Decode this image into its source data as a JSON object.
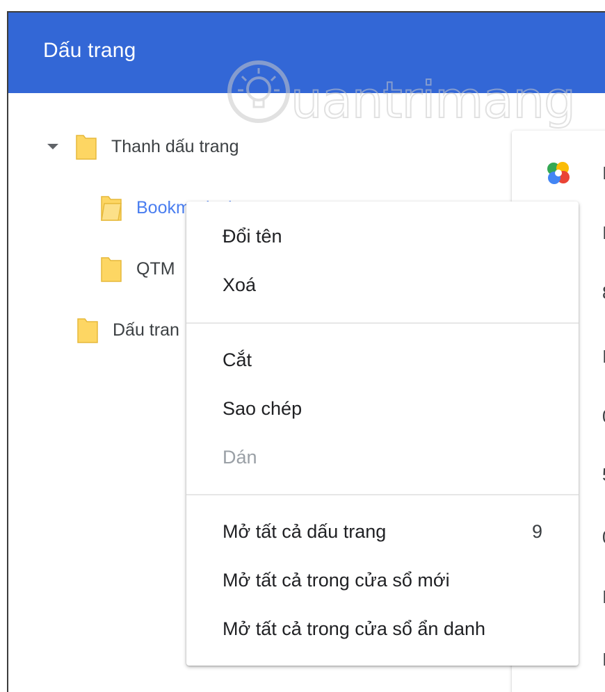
{
  "header": {
    "title": "Dấu trang"
  },
  "watermark": {
    "text": "uantrimang"
  },
  "tree": {
    "items": [
      {
        "label": "Thanh dấu trang",
        "expanded": true
      },
      {
        "label": "Bookmarks bar",
        "selected": true
      },
      {
        "label": "QTM"
      },
      {
        "label": "Dấu tran"
      }
    ]
  },
  "list": {
    "row_letters": [
      "I",
      "I",
      "8",
      "I",
      "0",
      "5",
      "0",
      "I",
      "I"
    ]
  },
  "context_menu": {
    "items": [
      {
        "label": "Đổi tên"
      },
      {
        "label": "Xoá"
      },
      {
        "label": "Cắt"
      },
      {
        "label": "Sao chép"
      },
      {
        "label": "Dán",
        "disabled": true
      },
      {
        "label": "Mở tất cả dấu trang",
        "count": "9"
      },
      {
        "label": "Mở tất cả trong cửa sổ mới"
      },
      {
        "label": "Mở tất cả trong cửa sổ ẩn danh"
      }
    ]
  },
  "colors": {
    "header_bg": "#3367d6",
    "selected_text": "#4a7ef0",
    "folder_fill": "#fdd663",
    "disabled_text": "#9aa0a6"
  }
}
